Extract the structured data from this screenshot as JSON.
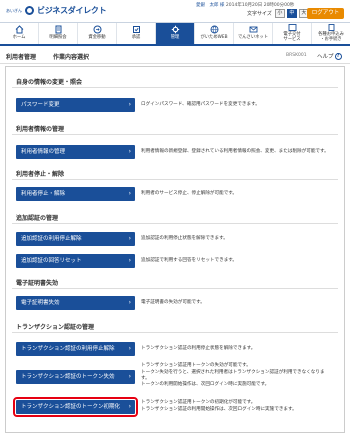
{
  "header": {
    "logo_small": "あいぎん",
    "logo_text": "ビジネスダイレクト",
    "user_label": "愛銀　太郎 様",
    "last_login": "2014年10月20日 20時00分00秒",
    "fontsize_label": "文字サイズ",
    "fontsize_options": [
      "小",
      "中",
      "大"
    ],
    "logout_label": "ログアウト"
  },
  "nav": {
    "items": [
      {
        "label": "ホーム",
        "icon": "home-icon"
      },
      {
        "label": "明細照会",
        "icon": "document-icon"
      },
      {
        "label": "資金移動",
        "icon": "transfer-icon"
      },
      {
        "label": "承認",
        "icon": "approve-icon"
      },
      {
        "label": "管理",
        "icon": "gear-icon"
      },
      {
        "label": "がいためWEB",
        "icon": "globe-icon"
      },
      {
        "label": "でんさいネット",
        "icon": "network-icon"
      },
      {
        "label": "電子交付\nサービス",
        "icon": "mail-icon"
      },
      {
        "label": "各種お申込み\n・お手続き",
        "icon": "form-icon"
      }
    ]
  },
  "titlebar": {
    "category": "利用者管理",
    "title": "作業内容選択",
    "screen_code": "BRSK001",
    "help_label": "ヘルプ"
  },
  "sections": [
    {
      "title": "自身の情報の変更・照会",
      "buttons": [
        {
          "label": "パスワード変更",
          "desc": [
            "ログインパスワード、確認用パスワードを変更できます。"
          ]
        }
      ]
    },
    {
      "title": "利用者情報の管理",
      "buttons": [
        {
          "label": "利用者情報の管理",
          "desc": [
            "利用者情報の新規登録、登録されている利用者情報の照会、変更、または削除が可能です。"
          ]
        }
      ]
    },
    {
      "title": "利用者停止・解除",
      "buttons": [
        {
          "label": "利用者停止・解除",
          "desc": [
            "利用者のサービス停止、停止解除が可能です。"
          ]
        }
      ]
    },
    {
      "title": "追加認証の管理",
      "buttons": [
        {
          "label": "追加認証の利用停止解除",
          "desc": [
            "追加認証の利用停止状態を解除できます。"
          ]
        },
        {
          "label": "追加認証の回答リセット",
          "desc": [
            "追加認証で利用する回答をリセットできます。"
          ]
        }
      ]
    },
    {
      "title": "電子証明書失効",
      "buttons": [
        {
          "label": "電子証明書失効",
          "desc": [
            "電子証明書の失効が可能です。"
          ]
        }
      ]
    },
    {
      "title": "トランザクション認証の管理",
      "buttons": [
        {
          "label": "トランザクション認証の利用停止解除",
          "desc": [
            "トランザクション認証の利用停止状態を解除できます。"
          ]
        },
        {
          "label": "トランザクション認証のトークン失効",
          "desc": [
            "トランザクション認証用トークンの失効が可能です。",
            "トークン失効を行うと、選択された利用者はトランザクション認証が利用できなくなりま",
            "す。",
            "トークンの利用開始操作は、次回ログイン時に実施可能です。"
          ]
        },
        {
          "label": "トランザクション認証のトークン初期化",
          "desc": [
            "トランザクション認証用トークンの初期化が可能です。",
            "トランザクション認証の利用開始操作は、次回ログイン時に実施できます。"
          ],
          "highlighted": true
        }
      ]
    }
  ]
}
